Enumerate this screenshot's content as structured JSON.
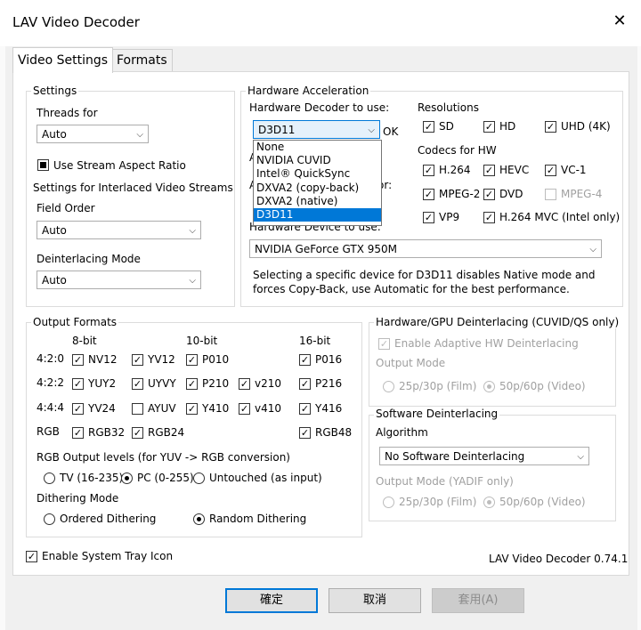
{
  "window": {
    "title": "LAV Video Decoder",
    "close_glyph": "✕"
  },
  "tabs": [
    "Video Settings",
    "Formats"
  ],
  "settings": {
    "group_title": "Settings",
    "threads_label": "Threads for",
    "threads_value": "Auto",
    "stream_aspect": "Use Stream Aspect Ratio",
    "interlaced_title": "Settings for Interlaced Video Streams",
    "field_order_label": "Field Order",
    "field_order_value": "Auto",
    "deint_mode_label": "Deinterlacing Mode",
    "deint_mode_value": "Auto"
  },
  "hwaccel": {
    "group_title": "Hardware Acceleration",
    "decoder_label": "Hardware Decoder to use:",
    "decoder_value": "D3D11",
    "status": "OK",
    "hidden_label_1": "A",
    "hidden_label_2": "A",
    "hidden_label_2_tail": "or:",
    "dropdown_options": [
      "None",
      "NVIDIA CUVID",
      "Intel® QuickSync",
      "DXVA2 (copy-back)",
      "DXVA2 (native)",
      "D3D11"
    ],
    "device_label": "Hardware Device to use:",
    "device_value": "NVIDIA GeForce GTX 950M",
    "note": "Selecting a specific device for D3D11 disables Native mode and forces Copy-Back, use Automatic for the best performance.",
    "resolutions_title": "Resolutions",
    "resolutions": [
      "SD",
      "HD",
      "UHD (4K)"
    ],
    "codecs_title": "Codecs for HW",
    "codecs": [
      "H.264",
      "HEVC",
      "VC-1",
      "MPEG-2",
      "DVD",
      "MPEG-4",
      "VP9",
      "H.264 MVC (Intel only)"
    ]
  },
  "output": {
    "group_title": "Output Formats",
    "col_8bit": "8-bit",
    "col_10bit": "10-bit",
    "col_16bit": "16-bit",
    "row_420": "4:2:0",
    "row_422": "4:2:2",
    "row_444": "4:4:4",
    "row_rgb": "RGB",
    "formats": {
      "nv12": "NV12",
      "yv12": "YV12",
      "p010": "P010",
      "p016": "P016",
      "yuy2": "YUY2",
      "uyvy": "UYVY",
      "p210": "P210",
      "v210": "v210",
      "p216": "P216",
      "yv24": "YV24",
      "ayuv": "AYUV",
      "y410": "Y410",
      "v410": "v410",
      "y416": "Y416",
      "rgb32": "RGB32",
      "rgb24": "RGB24",
      "rgb48": "RGB48"
    },
    "rgb_levels_title": "RGB Output levels (for YUV -> RGB conversion)",
    "levels": [
      "TV (16-235)",
      "PC (0-255)",
      "Untouched (as input)"
    ],
    "dither_title": "Dithering Mode",
    "dither": [
      "Ordered Dithering",
      "Random Dithering"
    ]
  },
  "hw_deint": {
    "group_title": "Hardware/GPU Deinterlacing (CUVID/QS only)",
    "adaptive": "Enable Adaptive HW Deinterlacing",
    "mode_label": "Output Mode",
    "modes": [
      "25p/30p (Film)",
      "50p/60p (Video)"
    ]
  },
  "sw_deint": {
    "group_title": "Software Deinterlacing",
    "algorithm_label": "Algorithm",
    "algorithm_value": "No Software Deinterlacing",
    "mode_label": "Output Mode (YADIF only)",
    "modes": [
      "25p/30p (Film)",
      "50p/60p (Video)"
    ]
  },
  "footer": {
    "tray_icon": "Enable System Tray Icon",
    "version": "LAV Video Decoder 0.74.1",
    "ok": "確定",
    "cancel": "取消",
    "apply": "套用(A)"
  },
  "colors": {
    "accent": "#0078d7",
    "disabled": "#a0a0a0"
  }
}
